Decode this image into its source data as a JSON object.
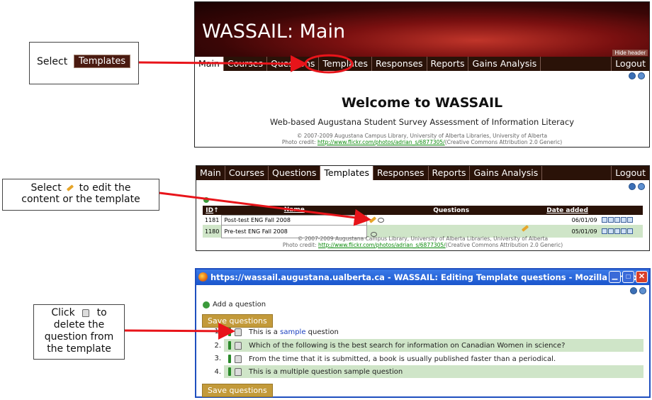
{
  "callouts": {
    "one": {
      "prefix": "Select",
      "button": "Templates"
    },
    "two": {
      "line1a": "Select",
      "line1b": "to edit the",
      "line2": "content or the template"
    },
    "three": {
      "line1a": "Click",
      "line1b": "to",
      "line2": "delete the",
      "line3": "question from",
      "line4": "the template"
    }
  },
  "panel1": {
    "header_title": "WASSAIL: Main",
    "hide_header": "Hide header",
    "nav": [
      "Main",
      "Courses",
      "Questions",
      "Templates",
      "Responses",
      "Reports",
      "Gains Analysis"
    ],
    "logout": "Logout",
    "welcome": "Welcome to WASSAIL",
    "subtitle": "Web-based Augustana Student Survey Assessment of Information Literacy",
    "credit1": "© 2007-2009 Augustana Campus Library, University of Alberta Libraries, University of Alberta",
    "credit2_prefix": "Photo credit:",
    "credit2_link": "http://www.flickr.com/photos/adrian_s/6877305/",
    "credit2_suffix": "(Creative Commons Attribution 2.0 Generic)"
  },
  "panel2": {
    "nav": [
      "Main",
      "Courses",
      "Questions",
      "Templates",
      "Responses",
      "Reports",
      "Gains Analysis"
    ],
    "logout": "Logout",
    "table_headers": {
      "id": "ID",
      "name": "Name",
      "questions": "Questions",
      "date": "Date added"
    },
    "rows": [
      {
        "id": "1181",
        "name": "Post-test ENG Fall 2008",
        "date": "06/01/09"
      },
      {
        "id": "1180",
        "name": "Pre-test ENG Fall 2008",
        "date": "05/01/09"
      }
    ],
    "credit1": "© 2007-2009 Augustana Campus Library, University of Alberta Libraries, University of Alberta",
    "credit2_prefix": "Photo credit:",
    "credit2_link": "http://www.flickr.com/photos/adrian_s/6877305/",
    "credit2_suffix": "(Creative Commons Attribution 2.0 Generic)"
  },
  "panel3": {
    "window_title": "https://wassail.augustana.ualberta.ca - WASSAIL: Editing Template questions - Mozilla Firefox",
    "add_question": "Add a question",
    "save_questions": "Save questions",
    "questions": [
      {
        "num": "1.",
        "pre": "This is a",
        "link": "sample",
        "post": "question"
      },
      {
        "num": "2.",
        "text": "Which of the following is the best search for information on Canadian Women in science?"
      },
      {
        "num": "3.",
        "text": "From the time that it is submitted, a book is usually published faster than a periodical."
      },
      {
        "num": "4.",
        "text": "This is a multiple question sample question"
      }
    ]
  },
  "colors": {
    "arrow": "#e8141a",
    "nav_bg": "#2a1208",
    "gold": "#c39a3a",
    "row_alt": "#cfe5c8"
  }
}
